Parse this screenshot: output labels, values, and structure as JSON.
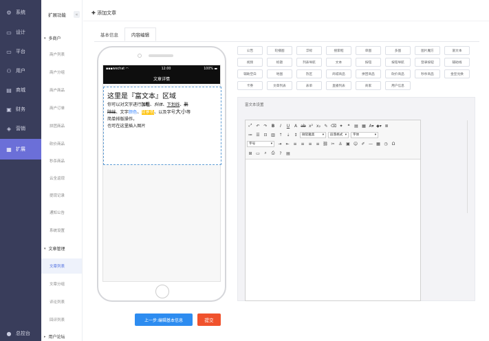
{
  "nav": {
    "items": [
      {
        "label": "系统",
        "icon": "gear-icon",
        "glyph": "⚙"
      },
      {
        "label": "设计",
        "icon": "monitor-icon",
        "glyph": "▭"
      },
      {
        "label": "平台",
        "icon": "platform-icon",
        "glyph": "▭"
      },
      {
        "label": "用户",
        "icon": "user-icon",
        "glyph": "⚇"
      },
      {
        "label": "商城",
        "icon": "store-icon",
        "glyph": "▤"
      },
      {
        "label": "财务",
        "icon": "finance-icon",
        "glyph": "▣"
      },
      {
        "label": "营销",
        "icon": "marketing-icon",
        "glyph": "◈"
      },
      {
        "label": "扩展",
        "icon": "extension-icon",
        "glyph": "▦"
      }
    ],
    "footer_label": "总控台",
    "footer_icon": "dashboard-icon"
  },
  "side": {
    "title": "扩展功能",
    "collapse_glyph": "«",
    "group_multi": "多商户",
    "multi_items": [
      "商户列表",
      "商户分组",
      "商户商品",
      "商户订单",
      "拼团商品",
      "砍价商品",
      "秒杀商品",
      "云全返现",
      "提现记录",
      "通知公告",
      "系统设置"
    ],
    "group_article": "文章管理",
    "article_items": [
      "文章列表",
      "文章分组",
      "评论列表",
      "回评列表"
    ],
    "group_forum": "用户论坛"
  },
  "main": {
    "page_title": "添加文章",
    "tabs": [
      "基本信息",
      "内容编辑"
    ],
    "active_tab": 1
  },
  "phone": {
    "carrier": "wechat",
    "time": "12:00",
    "battery": "100%",
    "title": "文章详情",
    "rich_heading": "这里是『富文本』区域",
    "rich_line1_a": "你可以对文字进行",
    "rich_bold": "加粗",
    "rich_sep1": "、",
    "rich_italic": "斜体",
    "rich_sep2": "、",
    "rich_under": "下划线",
    "rich_sep3": "、",
    "rich_strike1": "删",
    "rich_strike2": "除线",
    "rich_text_color_pre": "、文字",
    "rich_color": "颜色",
    "rich_sep4": "、",
    "rich_bg": "背景色",
    "rich_mid": "、以及字号",
    "rich_big": "大小",
    "rich_end": "等",
    "rich_line3": "简单排版操作。",
    "rich_line4": "也可在这里插入图片"
  },
  "components": [
    "公告",
    "轮播图",
    "浮标",
    "搜索框",
    "单图",
    "多图",
    "图片魔方",
    "富文本",
    "视频",
    "标题",
    "列表导航",
    "文本",
    "按钮",
    "按钮导航",
    "登录按钮",
    "辅助线",
    "辅助空白",
    "地图",
    "热区",
    "商城商品",
    "拼团商品",
    "砍价商品",
    "秒杀商品",
    "金豆兑换",
    "卡券",
    "文章列表",
    "表单",
    "直播列表",
    "商家",
    "用户信息"
  ],
  "editor": {
    "panel_title": "富文本设置",
    "font_family": "微软雅黑",
    "heading_style": "段落格式",
    "font_face": "字体",
    "font_size": "字号"
  },
  "buttons": {
    "prev": "上一步:编辑基本信息",
    "submit": "提交"
  }
}
